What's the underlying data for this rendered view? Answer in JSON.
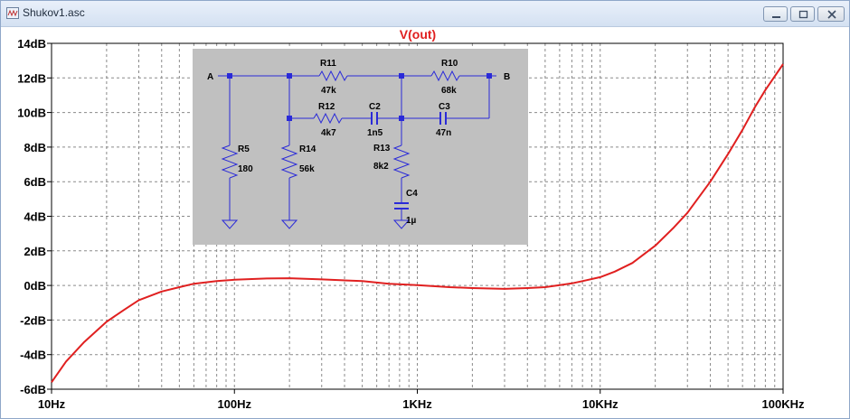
{
  "window": {
    "title": "Shukov1.asc",
    "icons": [
      "schematic-icon",
      "minimize-icon",
      "maximize-icon",
      "close-icon"
    ]
  },
  "chart_data": {
    "type": "line",
    "title": "V(out)",
    "xlabel": "",
    "ylabel": "",
    "xscale": "log",
    "xlim": [
      10,
      100000
    ],
    "ylim": [
      -6,
      14
    ],
    "grid": true,
    "grid_style": "dashed",
    "x_ticks": [
      {
        "value": 10,
        "label": "10Hz"
      },
      {
        "value": 100,
        "label": "100Hz"
      },
      {
        "value": 1000,
        "label": "1KHz"
      },
      {
        "value": 10000,
        "label": "10KHz"
      },
      {
        "value": 100000,
        "label": "100KHz"
      }
    ],
    "y_ticks": [
      {
        "value": 14,
        "label": "14dB"
      },
      {
        "value": 12,
        "label": "12dB"
      },
      {
        "value": 10,
        "label": "10dB"
      },
      {
        "value": 8,
        "label": "8dB"
      },
      {
        "value": 6,
        "label": "6dB"
      },
      {
        "value": 4,
        "label": "4dB"
      },
      {
        "value": 2,
        "label": "2dB"
      },
      {
        "value": 0,
        "label": "0dB"
      },
      {
        "value": -2,
        "label": "-2dB"
      },
      {
        "value": -4,
        "label": "-4dB"
      },
      {
        "value": -6,
        "label": "-6dB"
      }
    ],
    "series": [
      {
        "color": "#e02020",
        "x": [
          10,
          12,
          15,
          20,
          25,
          30,
          40,
          50,
          60,
          80,
          100,
          150,
          200,
          300,
          500,
          700,
          1000,
          1500,
          2000,
          3000,
          4000,
          5000,
          6000,
          7000,
          8000,
          10000,
          12000,
          15000,
          20000,
          25000,
          30000,
          40000,
          50000,
          60000,
          70000,
          80000,
          100000
        ],
        "y": [
          -5.6,
          -4.4,
          -3.3,
          -2.1,
          -1.4,
          -0.85,
          -0.35,
          -0.1,
          0.1,
          0.25,
          0.33,
          0.4,
          0.42,
          0.35,
          0.25,
          0.1,
          0.02,
          -0.1,
          -0.15,
          -0.2,
          -0.15,
          -0.1,
          0.02,
          0.12,
          0.25,
          0.48,
          0.8,
          1.3,
          2.3,
          3.3,
          4.2,
          6.0,
          7.6,
          9.0,
          10.3,
          11.3,
          12.8
        ]
      }
    ],
    "inset_schematic": {
      "nodes": [
        "A",
        "B"
      ],
      "components": [
        {
          "ref": "R11",
          "value": "47k"
        },
        {
          "ref": "R10",
          "value": "68k"
        },
        {
          "ref": "R12",
          "value": "4k7"
        },
        {
          "ref": "C2",
          "value": "1n5"
        },
        {
          "ref": "C3",
          "value": "47n"
        },
        {
          "ref": "R13",
          "value": "8k2"
        },
        {
          "ref": "C4",
          "value": "1µ"
        },
        {
          "ref": "R5",
          "value": "180"
        },
        {
          "ref": "R14",
          "value": "56k"
        }
      ]
    }
  }
}
